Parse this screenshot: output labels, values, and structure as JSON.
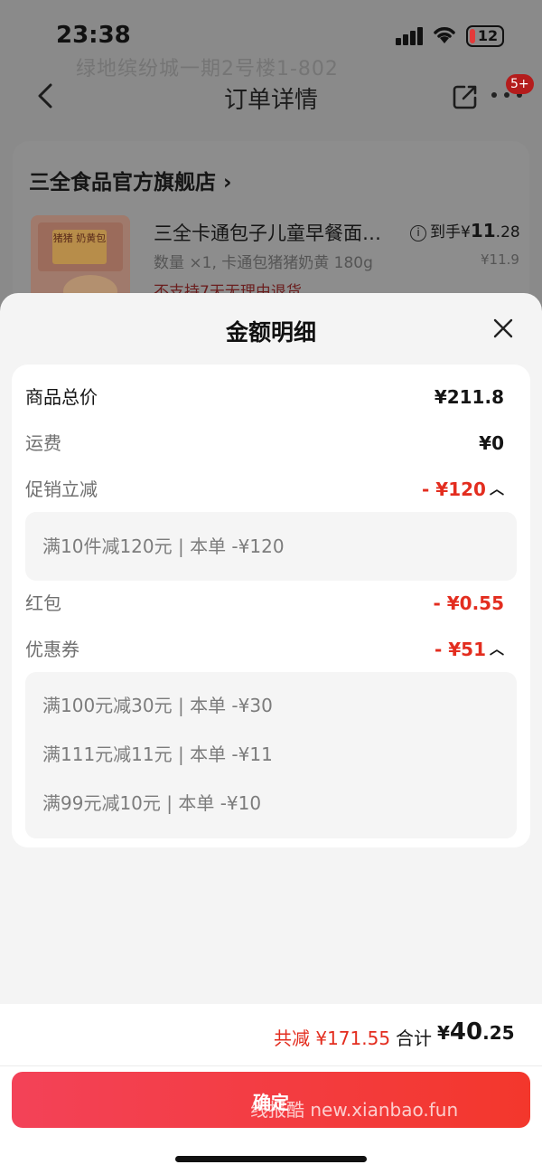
{
  "status_bar": {
    "time": "23:38",
    "battery": "12"
  },
  "background": {
    "address_ghost": "绿地缤纷城一期2号楼1-802",
    "nav_title": "订单详情",
    "badge": "5+",
    "store_name": "三全食品官方旗舰店",
    "store_chevron": "›",
    "product_name": "三全卡通包子儿童早餐面…",
    "product_spec": "数量 ×1, 卡通包猪猪奶黄 180g",
    "price_prefix": "到手",
    "price_yen": "¥",
    "price_int": "11",
    "price_dec": ".28",
    "original_price": "¥11.9",
    "peek_text": "不支持7天无理由退货",
    "package_label": "猪猪 奶黄包"
  },
  "sheet": {
    "title": "金额明细",
    "rows": [
      {
        "label": "商品总价",
        "value": "¥211.8"
      },
      {
        "label": "运费",
        "value": "¥0"
      },
      {
        "label": "促销立减",
        "value": "- ¥120"
      },
      {
        "label": "红包",
        "value": "- ¥0.55"
      },
      {
        "label": "优惠券",
        "value": "- ¥51"
      }
    ],
    "promotion_details": [
      "满10件减120元 | 本单 -¥120"
    ],
    "coupon_details": [
      "满100元减30元 | 本单 -¥30",
      "满111元减11元 | 本单 -¥11",
      "满99元减10元 | 本单 -¥10"
    ]
  },
  "footer": {
    "savings": "共减 ¥171.55",
    "total_label": "合计",
    "total_yen": "¥",
    "total_int": "40",
    "total_dec": ".25",
    "confirm_label": "确定",
    "watermark": "线报酷 new.xianbao.fun"
  },
  "colors": {
    "accent_red": "#e32d1f",
    "button_gradient_start": "#f34258",
    "button_gradient_end": "#f3372c",
    "sheet_bg": "#f4f4f4"
  },
  "icons": [
    "back-icon",
    "share-icon",
    "more-icon",
    "close-icon",
    "info-icon",
    "caret-up-icon",
    "wifi-icon",
    "signal-icon",
    "battery-icon"
  ]
}
